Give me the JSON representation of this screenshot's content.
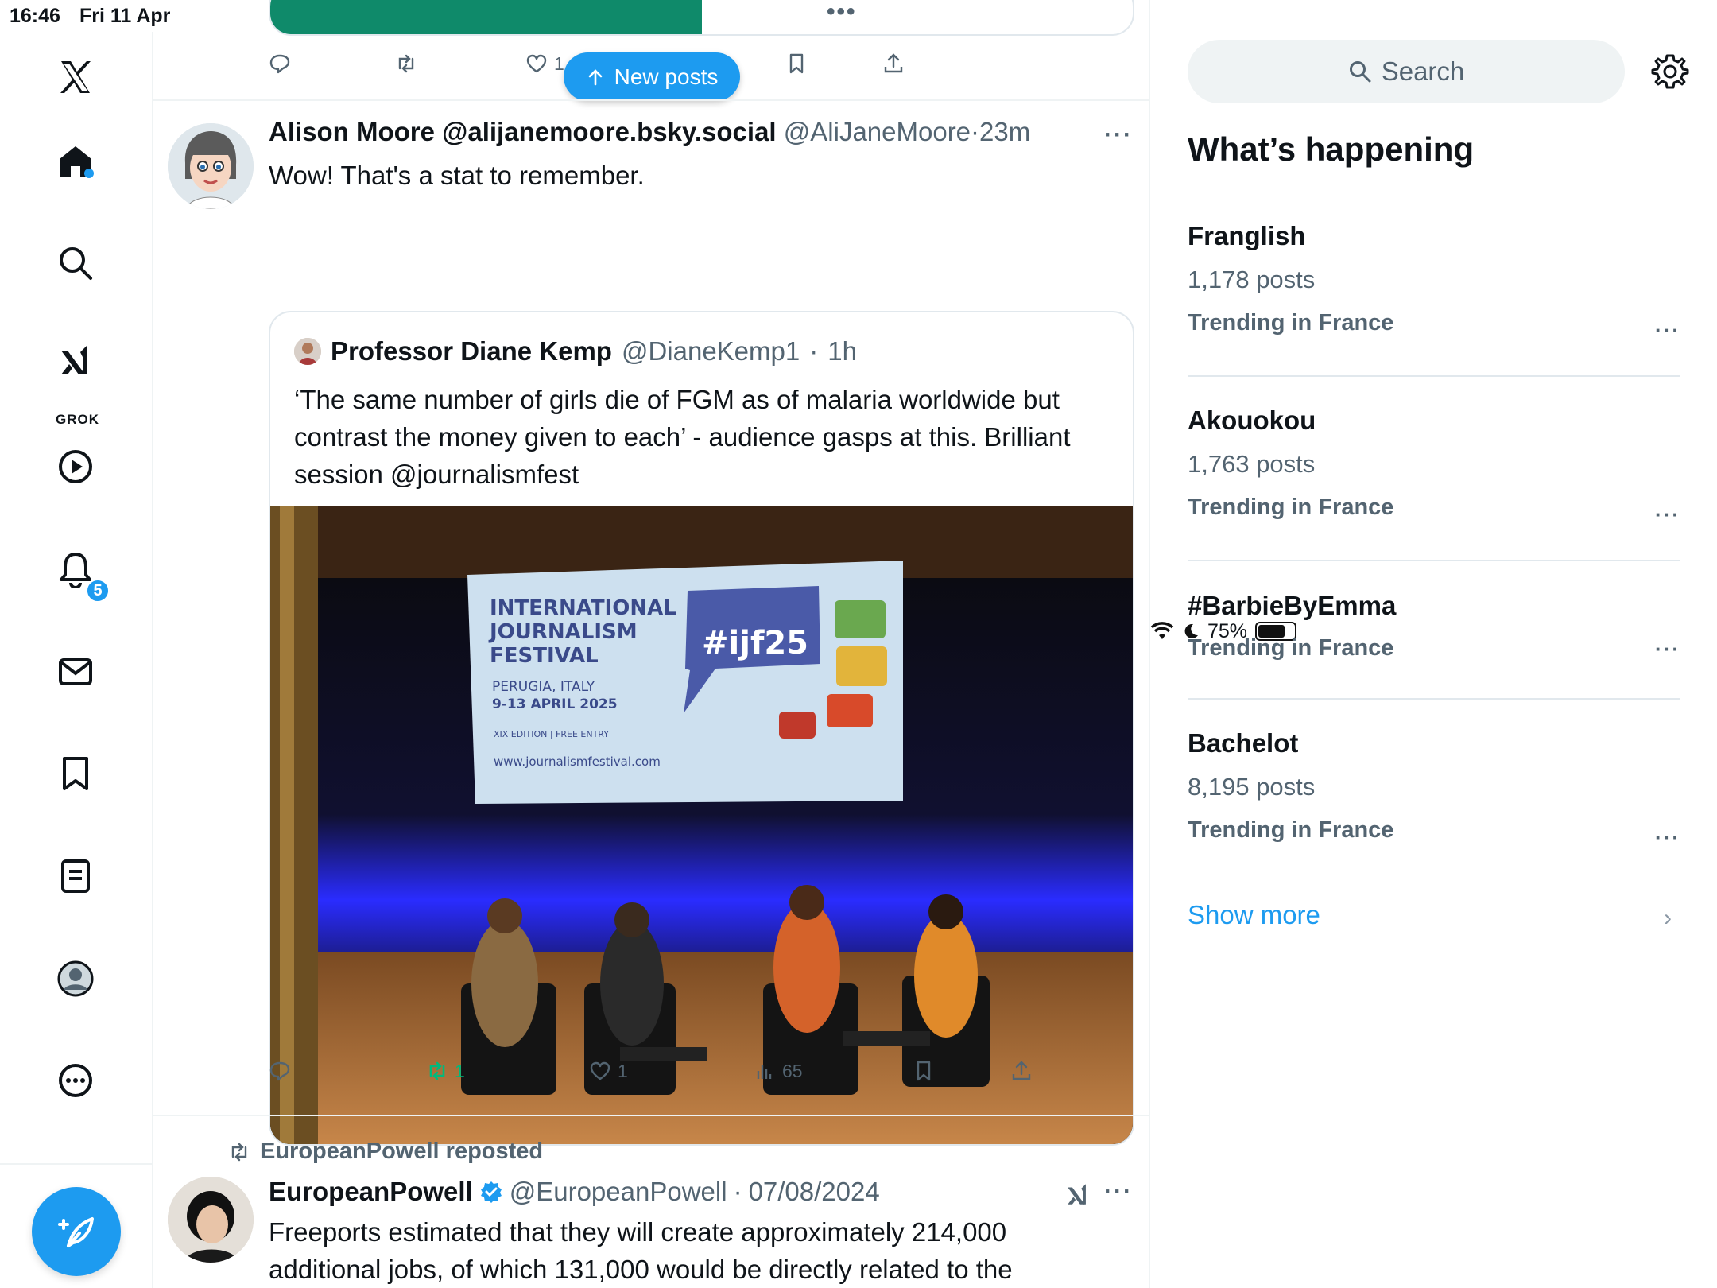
{
  "status": {
    "time": "16:46",
    "date": "Fri 11 Apr",
    "battery": "75%",
    "battery_level": 0.75
  },
  "nav": {
    "items": [
      "home",
      "explore",
      "grok",
      "videos",
      "notifications",
      "messages",
      "bookmarks",
      "lists",
      "profile",
      "more"
    ],
    "grok_label": "GROK",
    "notifications_badge": "5"
  },
  "top_post": {
    "video_progress": 0.5,
    "like_count": "1"
  },
  "new_posts_label": "New posts",
  "posts": [
    {
      "author_name": "Alison Moore @alijanemoore.bsky.social",
      "handle": "@AliJaneMoore",
      "time": "23m",
      "text": "Wow! That's a stat to remember.",
      "quote": {
        "author_name": "Professor Diane Kemp",
        "handle": "@DianeKemp1",
        "time": "1h",
        "text": "‘The same number of girls die of FGM as of malaria worldwide but contrast the money given to each’ - audience gasps at this. Brilliant session @journalismfest",
        "image": {
          "festival_line1": "INTERNATIONAL",
          "festival_line2": "JOURNALISM",
          "festival_line3": "FESTIVAL",
          "location": "PERUGIA, ITALY",
          "dates": "9-13 APRIL 2025",
          "edition": "XIX EDITION | FREE ENTRY",
          "url": "www.journalismfestival.com",
          "hashtag": "#ijf25"
        }
      },
      "reposts": "1",
      "likes": "1",
      "views": "65"
    },
    {
      "repost_label": "EuropeanPowell reposted",
      "author_name": "EuropeanPowell",
      "handle": "@EuropeanPowell",
      "time": "07/08/2024",
      "text_line1": "Freeports estimated that they will create approximately 214,000",
      "text_line2": "additional jobs, of which 131,000 would be directly related to the"
    }
  ],
  "search": {
    "placeholder": "Search"
  },
  "whats_happening": {
    "title": "What’s happening",
    "trends": [
      {
        "name": "Franglish",
        "posts": "1,178 posts",
        "context": "Trending in France"
      },
      {
        "name": "Akouokou",
        "posts": "1,763 posts",
        "context": "Trending in France"
      },
      {
        "name": "#BarbieByEmma",
        "posts": "",
        "context": "Trending in France"
      },
      {
        "name": "Bachelot",
        "posts": "8,195 posts",
        "context": "Trending in France"
      }
    ],
    "show_more": "Show more"
  },
  "colors": {
    "accent": "#1d9bf0",
    "repost_green": "#00ba7c",
    "muted": "#536471",
    "video_bar": "#0f8a6a"
  }
}
